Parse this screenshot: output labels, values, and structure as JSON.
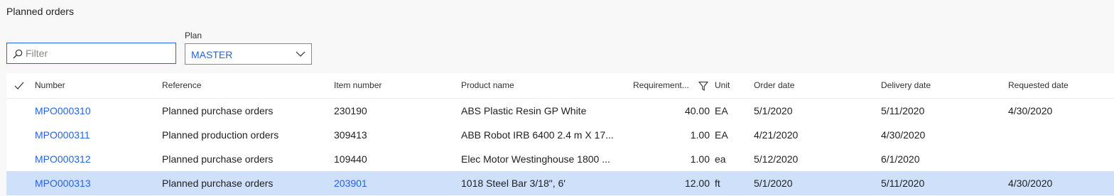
{
  "page": {
    "title": "Planned orders"
  },
  "filter": {
    "placeholder": "Filter",
    "value": ""
  },
  "plan": {
    "label": "Plan",
    "value": "MASTER"
  },
  "colors": {
    "link": "#2266e3",
    "selected_row": "#cfe0fa",
    "focus_border": "#2266e3"
  },
  "icons": {
    "search": "search-icon",
    "chevron": "chevron-down-icon",
    "checkmark": "checkmark-icon",
    "filter": "filter-icon"
  },
  "columns": {
    "number": "Number",
    "reference": "Reference",
    "item_number": "Item number",
    "product_name": "Product name",
    "requirement": "Requirement...",
    "unit": "Unit",
    "order_date": "Order date",
    "delivery_date": "Delivery date",
    "requested_date": "Requested date"
  },
  "rows": [
    {
      "number": "MPO000310",
      "reference": "Planned purchase orders",
      "item_number": "230190",
      "product_name": "ABS Plastic Resin GP White",
      "requirement": "40.00",
      "unit": "EA",
      "order_date": "5/1/2020",
      "delivery_date": "5/11/2020",
      "requested_date": "4/30/2020"
    },
    {
      "number": "MPO000311",
      "reference": "Planned production orders",
      "item_number": "309413",
      "product_name": "ABB Robot IRB 6400 2.4 m X 17...",
      "requirement": "1.00",
      "unit": "EA",
      "order_date": "4/21/2020",
      "delivery_date": "4/30/2020",
      "requested_date": ""
    },
    {
      "number": "MPO000312",
      "reference": "Planned purchase orders",
      "item_number": "109440",
      "product_name": "Elec Motor Westinghouse 1800 ...",
      "requirement": "1.00",
      "unit": "ea",
      "order_date": "5/12/2020",
      "delivery_date": "6/1/2020",
      "requested_date": ""
    },
    {
      "number": "MPO000313",
      "reference": "Planned purchase orders",
      "item_number": "203901",
      "product_name": "1018 Steel Bar 3/18\", 6'",
      "requirement": "12.00",
      "unit": "ft",
      "order_date": "5/1/2020",
      "delivery_date": "5/11/2020",
      "requested_date": "4/30/2020",
      "selected": true
    }
  ]
}
